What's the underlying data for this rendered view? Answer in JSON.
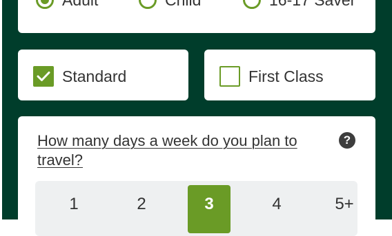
{
  "passenger_types": [
    {
      "label": "Adult",
      "selected": true
    },
    {
      "label": "Child",
      "selected": false
    },
    {
      "label": "16-17 Saver",
      "selected": false
    }
  ],
  "travel_class": {
    "standard": {
      "label": "Standard",
      "checked": true
    },
    "first": {
      "label": "First Class",
      "checked": false
    }
  },
  "days": {
    "question": "How many days a week do you plan to travel?",
    "help_icon": "?",
    "options": [
      "1",
      "2",
      "3",
      "4",
      "5+"
    ],
    "selected": "3"
  },
  "colors": {
    "background": "#003d2b",
    "accent": "#6a9b26",
    "card": "#ffffff",
    "day_bar": "#eef0f1",
    "text": "#333333"
  }
}
